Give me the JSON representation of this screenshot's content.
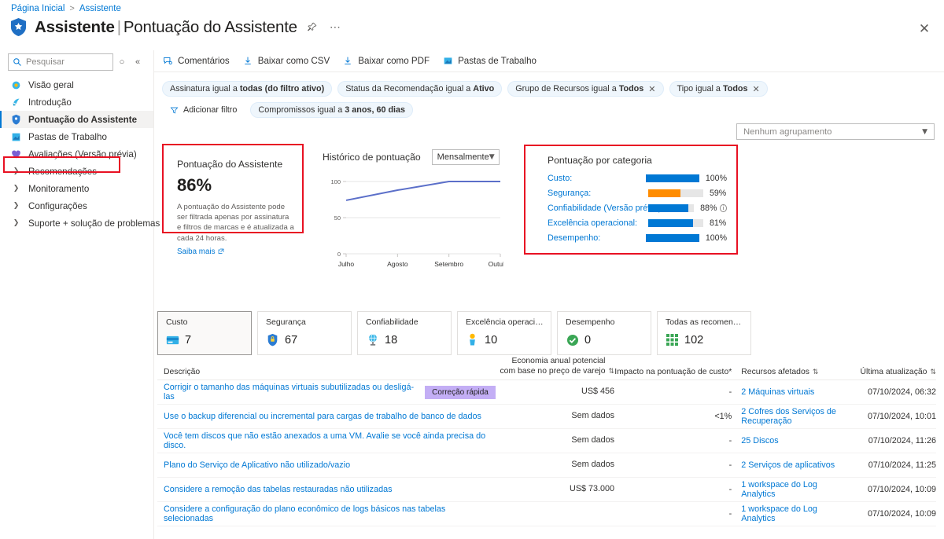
{
  "breadcrumb": {
    "home": "Página Inicial",
    "current": "Assistente"
  },
  "header": {
    "title_main": "Assistente",
    "title_sub": "Pontuação do Assistente",
    "pin_icon": "pin-icon",
    "more_icon": "ellipsis-icon",
    "close_icon": "close-icon"
  },
  "sidebar": {
    "search": {
      "placeholder": "Pesquisar",
      "value": ""
    },
    "refresh_icon": "refresh-icon",
    "collapse_icon": "collapse-icon",
    "items": [
      {
        "label": "Visão geral",
        "icon": "overview-icon",
        "type": "icon",
        "selected": false
      },
      {
        "label": "Introdução",
        "icon": "rocket-icon",
        "type": "icon",
        "selected": false
      },
      {
        "label": "Pontuação do Assistente",
        "icon": "shield-icon",
        "type": "icon",
        "selected": true
      },
      {
        "label": "Pastas de Trabalho",
        "icon": "workbook-icon",
        "type": "icon",
        "selected": false
      },
      {
        "label": "Avaliações (Versão prévia)",
        "icon": "heart-icon",
        "type": "icon",
        "selected": false
      },
      {
        "label": "Recomendações",
        "icon": "chevron-right-icon",
        "type": "chevron",
        "selected": false
      },
      {
        "label": "Monitoramento",
        "icon": "chevron-right-icon",
        "type": "chevron",
        "selected": false
      },
      {
        "label": "Configurações",
        "icon": "chevron-right-icon",
        "type": "chevron",
        "selected": false
      },
      {
        "label": "Suporte + solução de problemas",
        "icon": "chevron-right-icon",
        "type": "chevron",
        "selected": false
      }
    ]
  },
  "toolbar": [
    {
      "label": "Comentários",
      "icon": "feedback-icon"
    },
    {
      "label": "Baixar como CSV",
      "icon": "download-icon"
    },
    {
      "label": "Baixar como PDF",
      "icon": "download-icon"
    },
    {
      "label": "Pastas de Trabalho",
      "icon": "workbook-icon"
    }
  ],
  "filters": {
    "pills": [
      {
        "prefix": "Assinatura igual a ",
        "value": "todas (do filtro ativo)",
        "removable": false
      },
      {
        "prefix": "Status da Recomendação igual a ",
        "value": "Ativo",
        "removable": false
      },
      {
        "prefix": "Grupo de Recursos igual a ",
        "value": "Todos",
        "removable": true
      },
      {
        "prefix": "Tipo igual a ",
        "value": "Todos",
        "removable": true
      },
      {
        "prefix": "Compromissos igual a ",
        "value": "3 anos, 60 dias",
        "removable": false
      }
    ],
    "add_filter_label": "Adicionar filtro",
    "add_filter_icon": "funnel-icon"
  },
  "grouping": {
    "value": "Nenhum agrupamento",
    "icon": "chevron-down-icon"
  },
  "score_card": {
    "title": "Pontuação do Assistente",
    "score": "86%",
    "description": "A pontuação do Assistente pode ser filtrada apenas por assinatura e filtros de marcas e é atualizada a cada 24 horas.",
    "link_label": "Saiba mais",
    "link_icon": "external-link-icon"
  },
  "history": {
    "title": "Histórico de pontuação",
    "period": "Mensalmente",
    "period_icon": "chevron-down-icon"
  },
  "categories": {
    "title": "Pontuação por categoria",
    "rows": [
      {
        "label": "Custo:",
        "pct": 100,
        "text": "100%",
        "color": "#0078d4",
        "info": false
      },
      {
        "label": "Segurança:",
        "pct": 59,
        "text": "59%",
        "color": "#ff8c00",
        "info": false
      },
      {
        "label": "Confiabilidade (Versão prévia):",
        "pct": 88,
        "text": "88%",
        "color": "#0078d4",
        "info": true
      },
      {
        "label": "Excelência operacional:",
        "pct": 81,
        "text": "81%",
        "color": "#0078d4",
        "info": false
      },
      {
        "label": "Desempenho:",
        "pct": 100,
        "text": "100%",
        "color": "#0078d4",
        "info": false
      }
    ]
  },
  "stat_cards": [
    {
      "title": "Custo",
      "value": "7",
      "icon": "cost-icon",
      "active": true
    },
    {
      "title": "Segurança",
      "value": "67",
      "icon": "security-shield-icon",
      "active": false
    },
    {
      "title": "Confiabilidade",
      "value": "18",
      "icon": "reliability-globe-icon",
      "active": false
    },
    {
      "title": "Excelência operacional",
      "value": "10",
      "icon": "operational-excellence-icon",
      "active": false
    },
    {
      "title": "Desempenho",
      "value": "0",
      "icon": "performance-check-icon",
      "active": false
    },
    {
      "title": "Todas as recomendações",
      "value": "102",
      "icon": "grid-icon",
      "active": false
    }
  ],
  "table": {
    "headers": {
      "description": "Descrição",
      "savings": "Economia anual potencial com base no preço de varejo",
      "impact": "Impacto na pontuação de custo*",
      "resources": "Recursos afetados",
      "updated": "Última atualização"
    },
    "rows": [
      {
        "description": "Corrigir o tamanho das máquinas virtuais subutilizadas ou desligá-las",
        "badge": "Correção rápida",
        "savings": "US$ 456",
        "impact": "-",
        "resources": "2 Máquinas virtuais",
        "updated": "07/10/2024, 06:32"
      },
      {
        "description": "Use o backup diferencial ou incremental para cargas de trabalho de banco de dados",
        "badge": "",
        "savings": "Sem dados",
        "impact": "<1%",
        "resources": "2 Cofres dos Serviços de Recuperação",
        "updated": "07/10/2024, 10:01"
      },
      {
        "description": "Você tem discos que não estão anexados a uma VM. Avalie se você ainda precisa do disco.",
        "badge": "",
        "savings": "Sem dados",
        "impact": "-",
        "resources": "25 Discos",
        "updated": "07/10/2024, 11:26"
      },
      {
        "description": "Plano do Serviço de Aplicativo não utilizado/vazio",
        "badge": "",
        "savings": "Sem dados",
        "impact": "-",
        "resources": "2 Serviços de aplicativos",
        "updated": "07/10/2024, 11:25"
      },
      {
        "description": "Considere a remoção das tabelas restauradas não utilizadas",
        "badge": "",
        "savings": "US$ 73.000",
        "impact": "-",
        "resources": "1 workspace do Log Analytics",
        "updated": "07/10/2024, 10:09"
      },
      {
        "description": "Considere a configuração do plano econômico de logs básicos nas tabelas selecionadas",
        "badge": "",
        "savings": "",
        "impact": "-",
        "resources": "1 workspace do Log Analytics",
        "updated": "07/10/2024, 10:09"
      }
    ]
  },
  "chart_data": {
    "type": "line",
    "title": "Histórico de pontuação",
    "categories": [
      "Julho",
      "Agosto",
      "Setembro",
      "Outubro"
    ],
    "values": [
      74,
      88,
      100,
      100
    ],
    "ylim": [
      0,
      100
    ],
    "yticks": [
      0,
      50,
      100
    ],
    "xlabel": "",
    "ylabel": "",
    "grid": true,
    "series_color": "#5b6fc9",
    "legend": "none"
  }
}
